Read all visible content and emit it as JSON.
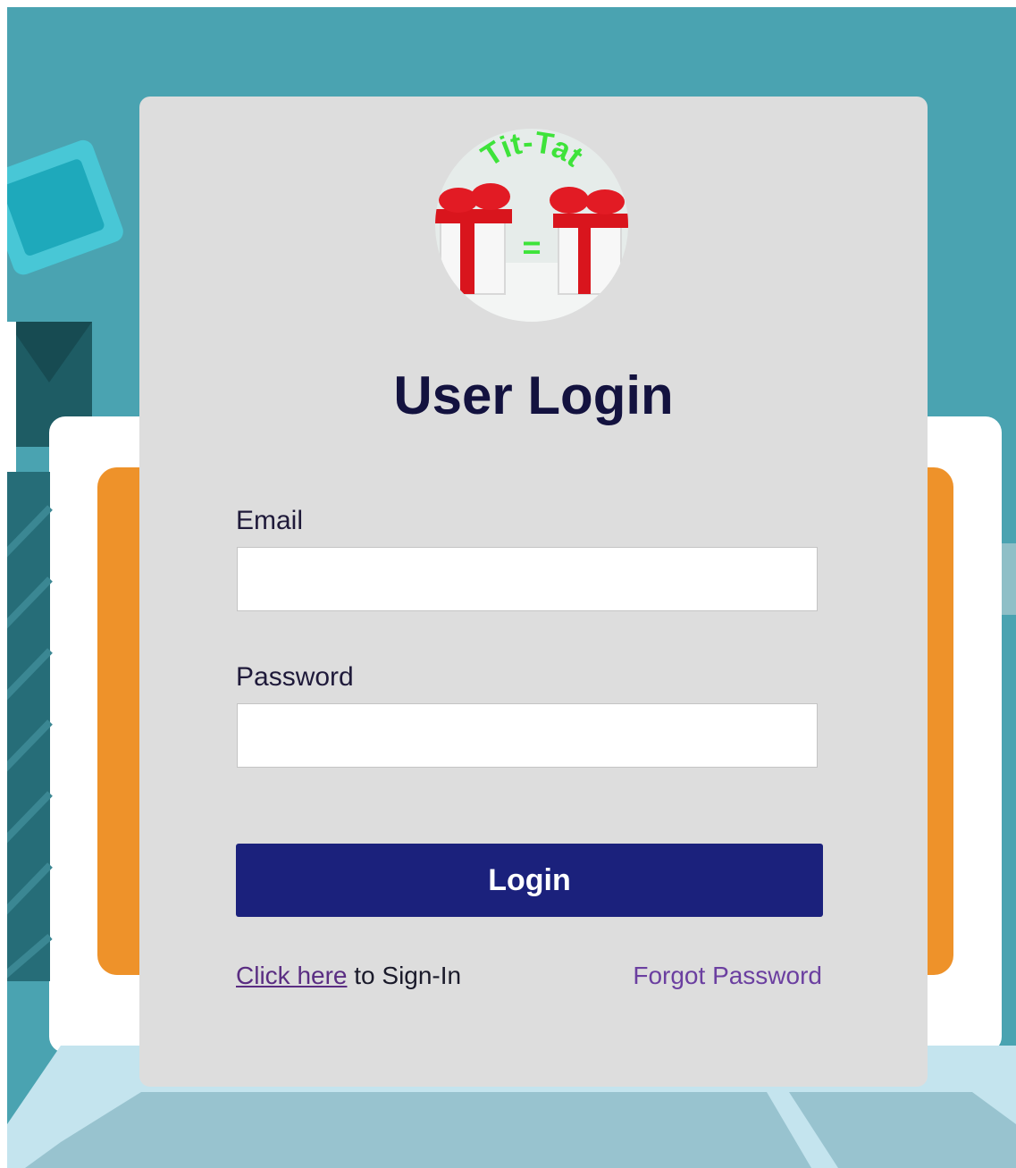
{
  "logo": {
    "alt": "Tit-Tat gift boxes logo",
    "text": "Tit-Tat",
    "symbol": "="
  },
  "title": "User Login",
  "form": {
    "email_label": "Email",
    "email_value": "",
    "password_label": "Password",
    "password_value": "",
    "login_label": "Login"
  },
  "footer": {
    "signin_link": "Click here",
    "signin_suffix": " to Sign-In",
    "forgot_link": "Forgot Password"
  },
  "colors": {
    "background_teal": "#4aa3b1",
    "card": "#dddddd",
    "title": "#13123f",
    "button": "#1b217c",
    "link": "#6b3fa0",
    "laptop_orange": "#ee922a"
  }
}
